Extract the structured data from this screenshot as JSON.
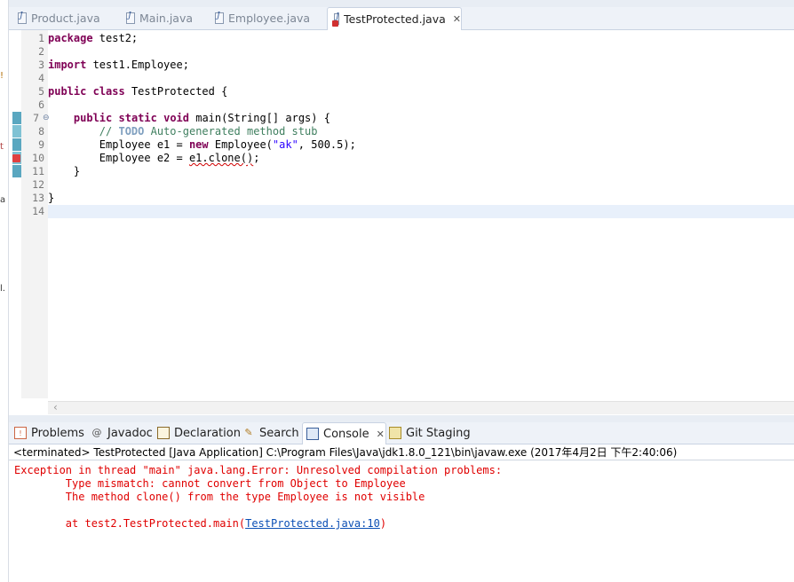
{
  "editor_tabs": [
    {
      "label": "Product.java",
      "active": false
    },
    {
      "label": "Main.java",
      "active": false
    },
    {
      "label": "Employee.java",
      "active": false
    },
    {
      "label": "TestProtected.java",
      "active": true,
      "close": "✕"
    }
  ],
  "code": {
    "line_numbers": [
      "1",
      "2",
      "3",
      "4",
      "5",
      "6",
      "7",
      "8",
      "9",
      "10",
      "11",
      "12",
      "13",
      "14"
    ],
    "l1_kw": "package",
    "l1_rest": " test2;",
    "l3_kw": "import",
    "l3_rest": " test1.Employee;",
    "l5_kw1": "public",
    "l5_kw2": "class",
    "l5_rest": " TestProtected {",
    "l7_indent": "    ",
    "l7_kw1": "public",
    "l7_kw2": "static",
    "l7_kw3": "void",
    "l7_rest": " main(String[] args) {",
    "l8_indent": "        ",
    "l8_cmt1": "// ",
    "l8_todo": "TODO",
    "l8_cmt2": " Auto-generated method stub",
    "l9_a": "        Employee e1 = ",
    "l9_kw": "new",
    "l9_b": " Employee(",
    "l9_str": "\"ak\"",
    "l9_c": ", 500.5);",
    "l10_a": "        Employee e2 = ",
    "l10_err": "e1.clone()",
    "l10_b": ";",
    "l11": "    }",
    "l13": "}"
  },
  "view_tabs": [
    {
      "label": "Problems",
      "icon": "problems-icon"
    },
    {
      "label": "Javadoc",
      "icon": "at-icon",
      "glyph": "@"
    },
    {
      "label": "Declaration",
      "icon": "declaration-icon"
    },
    {
      "label": "Search",
      "icon": "flashlight-icon"
    },
    {
      "label": "Console",
      "icon": "console-icon",
      "active": true,
      "close": "✕"
    },
    {
      "label": "Git Staging",
      "icon": "git-staging-icon"
    }
  ],
  "console": {
    "header": "<terminated> TestProtected [Java Application] C:\\Program Files\\Java\\jdk1.8.0_121\\bin\\javaw.exe (2017年4月2日 下午2:40:06)",
    "line1": "Exception in thread \"main\" java.lang.Error: Unresolved compilation problems: ",
    "line2": "\tType mismatch: cannot convert from Object to Employee",
    "line3": "\tThe method clone() from the type Employee is not visible",
    "line5_prefix": "\tat test2.TestProtected.main(",
    "line5_link": "TestProtected.java:10",
    "line5_suffix": ")"
  },
  "colors": {
    "keyword": "#7f0055",
    "string": "#2a00ff",
    "comment": "#3f7f5f",
    "error": "#e00000",
    "link": "#0b4fb5"
  }
}
